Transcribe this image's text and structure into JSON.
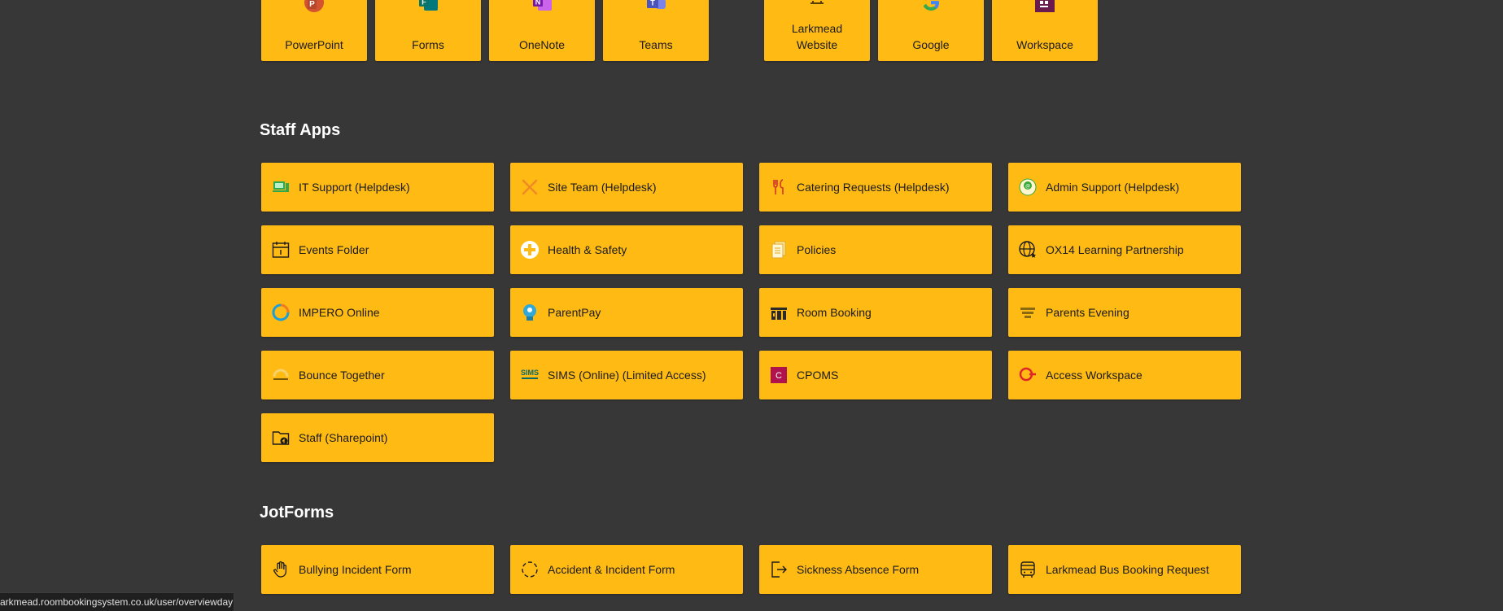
{
  "top_tiles": [
    {
      "label": "PowerPoint",
      "icon": "powerpoint-icon"
    },
    {
      "label": "Forms",
      "icon": "forms-icon"
    },
    {
      "label": "OneNote",
      "icon": "onenote-icon"
    },
    {
      "label": "Teams",
      "icon": "teams-icon"
    },
    {
      "label": "Larkmead Website",
      "icon": "larkmead-logo-icon"
    },
    {
      "label": "Google",
      "icon": "google-icon"
    },
    {
      "label": "Workspace",
      "icon": "workspace-icon"
    }
  ],
  "staff_apps": {
    "title": "Staff Apps",
    "items": [
      {
        "label": "IT Support (Helpdesk)",
        "icon": "it-support-icon"
      },
      {
        "label": "Site Team (Helpdesk)",
        "icon": "site-team-icon"
      },
      {
        "label": "Catering Requests (Helpdesk)",
        "icon": "catering-icon"
      },
      {
        "label": "Admin Support (Helpdesk)",
        "icon": "admin-support-icon"
      },
      {
        "label": "Events Folder",
        "icon": "calendar-icon"
      },
      {
        "label": "Health & Safety",
        "icon": "first-aid-icon"
      },
      {
        "label": "Policies",
        "icon": "documents-icon"
      },
      {
        "label": "OX14 Learning Partnership",
        "icon": "globe-icon"
      },
      {
        "label": "IMPERO Online",
        "icon": "impero-icon"
      },
      {
        "label": "ParentPay",
        "icon": "parentpay-icon"
      },
      {
        "label": "Room Booking",
        "icon": "room-booking-icon"
      },
      {
        "label": "Parents Evening",
        "icon": "parents-evening-icon"
      },
      {
        "label": "Bounce Together",
        "icon": "bounce-together-icon"
      },
      {
        "label": "SIMS (Online) (Limited Access)",
        "icon": "sims-icon"
      },
      {
        "label": "CPOMS",
        "icon": "cpoms-icon"
      },
      {
        "label": "Access Workspace",
        "icon": "access-workspace-icon"
      },
      {
        "label": "Staff (Sharepoint)",
        "icon": "folder-share-icon"
      }
    ]
  },
  "jotforms": {
    "title": "JotForms",
    "items": [
      {
        "label": "Bullying Incident Form",
        "icon": "hand-stop-icon"
      },
      {
        "label": "Accident & Incident Form",
        "icon": "dashed-circle-icon"
      },
      {
        "label": "Sickness Absence Form",
        "icon": "sign-out-icon"
      },
      {
        "label": "Larkmead Bus Booking Request",
        "icon": "bus-icon"
      }
    ]
  },
  "status_bar": {
    "url": "arkmead.roombookingsystem.co.uk/user/overviewday"
  },
  "colors": {
    "background": "#373737",
    "tile": "#ffba14",
    "text_dark": "#1b1b1b",
    "heading": "#ffffff"
  }
}
